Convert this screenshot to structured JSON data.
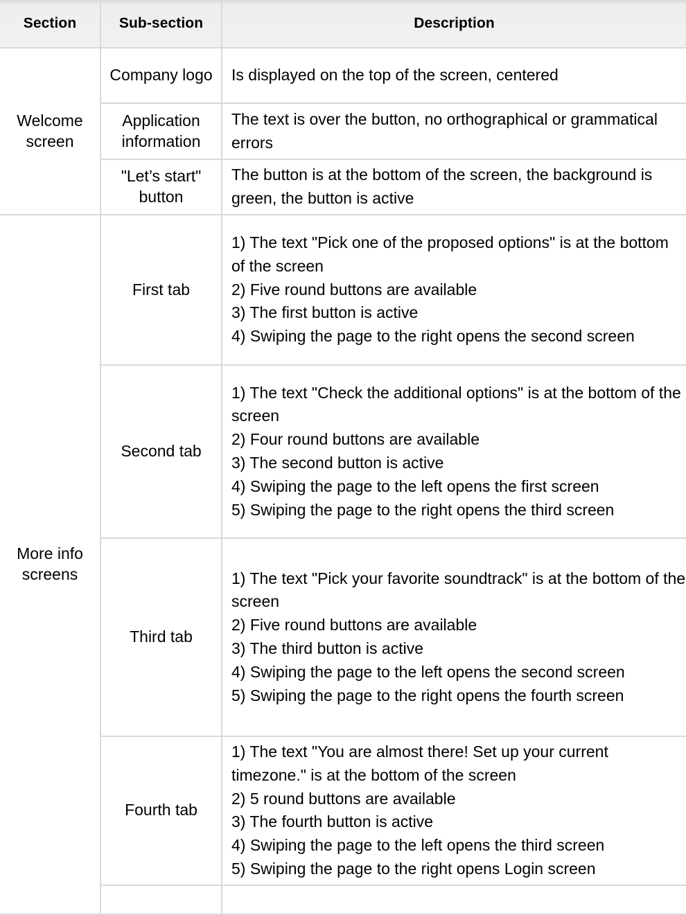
{
  "table": {
    "columns": [
      "Section",
      "Sub-section",
      "Description"
    ],
    "sections": [
      {
        "name": "Welcome screen",
        "rows": [
          {
            "subsection": "Company logo",
            "description": "Is displayed on the top of the screen, centered"
          },
          {
            "subsection": "Application information",
            "description": "The text is over the button, no orthographical or grammatical errors"
          },
          {
            "subsection": "\"Let’s start\" button",
            "description": "The button is at the bottom of the screen, the background is green, the button is active"
          }
        ]
      },
      {
        "name": "More info screens",
        "rows": [
          {
            "subsection": "First tab",
            "description": "1) The text \"Pick one of the proposed options\" is at the bottom of the screen\n2) Five round buttons are available\n3) The first button is active\n4) Swiping the page to the right opens the second screen"
          },
          {
            "subsection": "Second tab",
            "description": "1) The text \"Check the additional options\" is at the bottom of the screen\n2) Four round buttons are available\n3) The second button is active\n4) Swiping the page to the left opens the first screen\n5) Swiping the page to the right opens the third screen"
          },
          {
            "subsection": "Third tab",
            "description": "1) The text \"Pick your favorite soundtrack\" is at the bottom of the screen\n2) Five round buttons are available\n3) The third button is active\n4) Swiping the page to the left opens the second screen\n5) Swiping the page to the right opens the fourth screen"
          },
          {
            "subsection": "Fourth tab",
            "description": "1) The text \"You are almost there! Set up your current timezone.\" is at the bottom of the screen\n2) 5 round buttons are available\n3) The fourth button is active\n4) Swiping the page to the left opens the third screen\n5) Swiping the page to the right opens Login screen"
          }
        ]
      }
    ]
  },
  "colors": {
    "header_background": "#f1f1f1",
    "border": "#d9d9d9",
    "text": "#000000",
    "body_background": "#ffffff"
  }
}
